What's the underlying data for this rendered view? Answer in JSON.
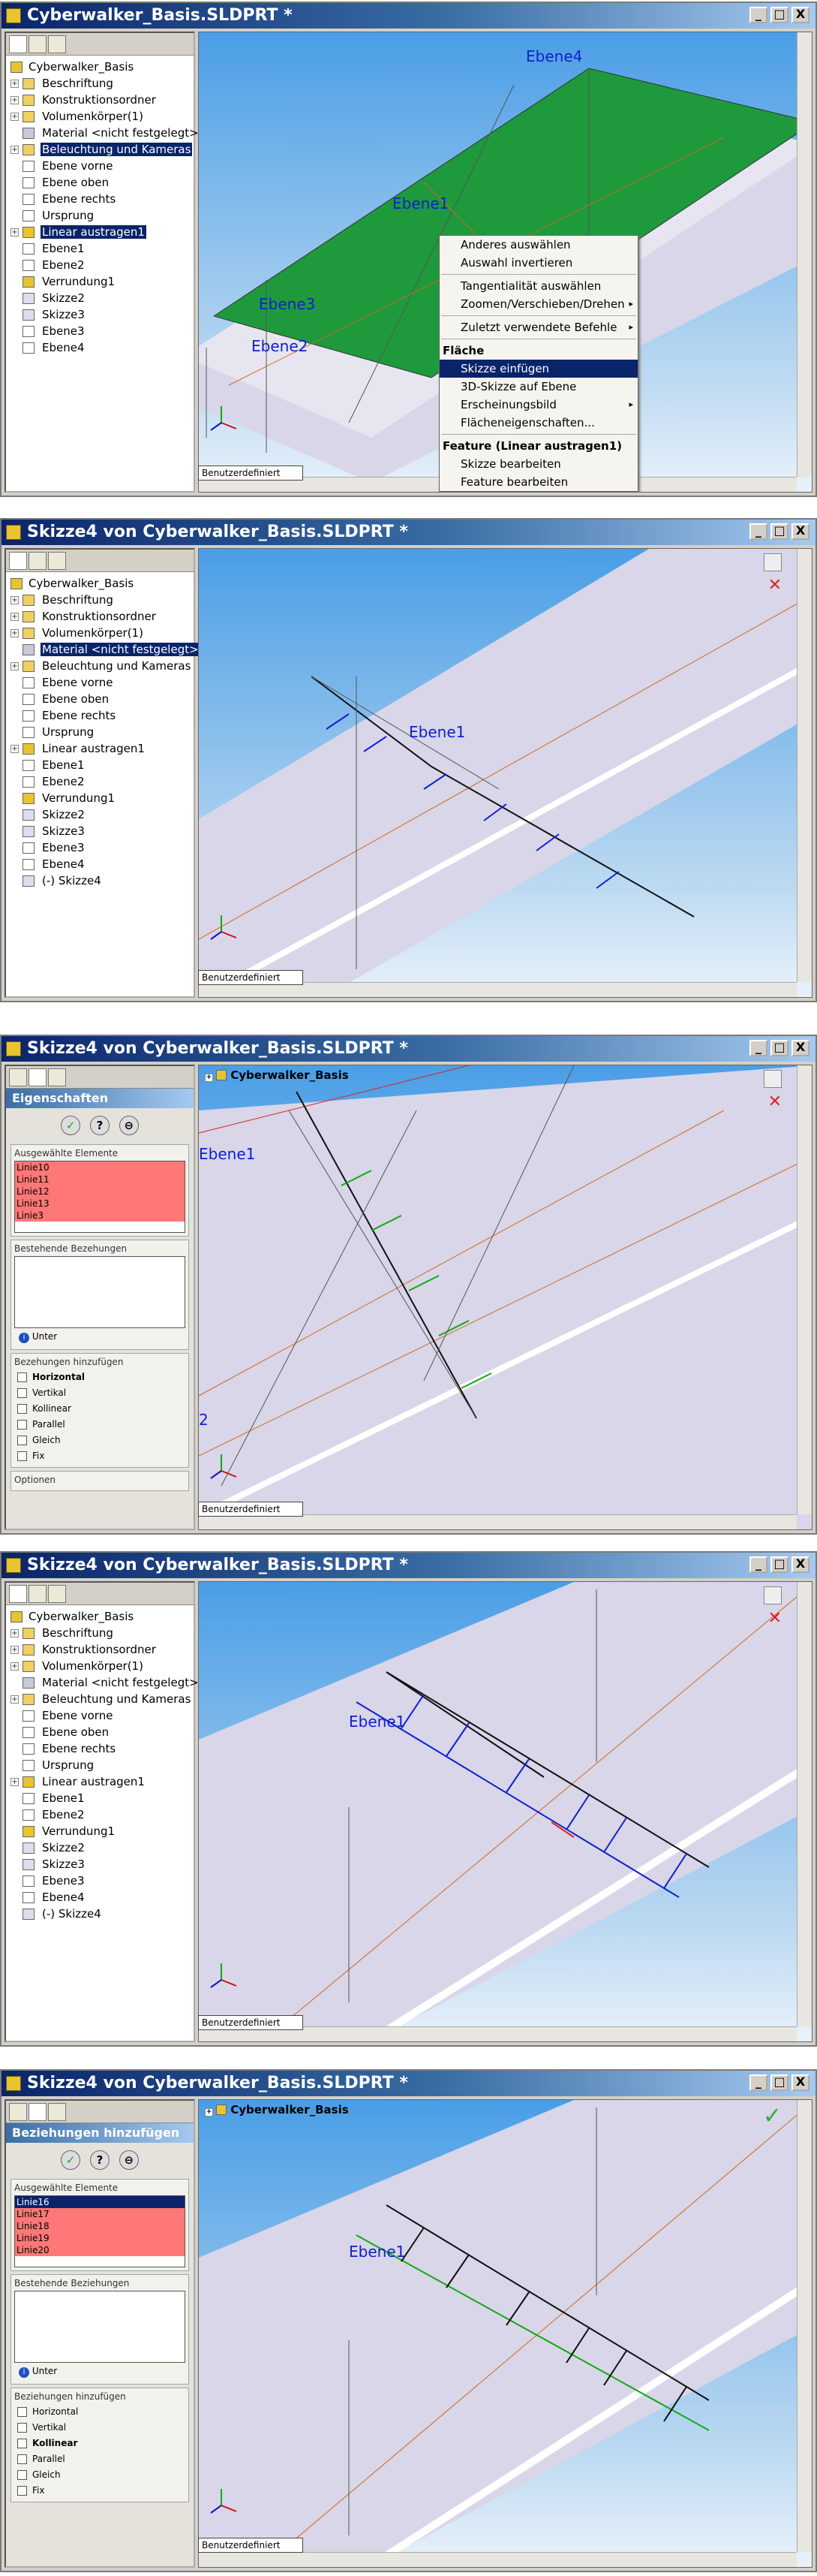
{
  "colors": {
    "titlebar": "#0a246a",
    "viewport_top": "#4a9ee6",
    "face_green": "#1e9a3c",
    "sketch_blue": "#1020d0",
    "sel_red": "#ff8080"
  },
  "window_controls": {
    "minimize": "_",
    "maximize": "□",
    "close": "X"
  },
  "panel1": {
    "title": "Cyberwalker_Basis.SLDPRT *",
    "tree": [
      {
        "label": "Cyberwalker_Basis",
        "icon": "part-icon"
      },
      {
        "label": "Beschriftung",
        "icon": "annotation-icon"
      },
      {
        "label": "Konstruktionsordner",
        "icon": "folder-icon"
      },
      {
        "label": "Volumenkörper(1)",
        "icon": "solid-body-icon"
      },
      {
        "label": "Material <nicht festgelegt>",
        "icon": "material-icon"
      },
      {
        "label": "Beleuchtung und Kameras",
        "icon": "lights-icon"
      },
      {
        "label": "Ebene vorne",
        "icon": "plane-icon"
      },
      {
        "label": "Ebene oben",
        "icon": "plane-icon"
      },
      {
        "label": "Ebene rechts",
        "icon": "plane-icon"
      },
      {
        "label": "Ursprung",
        "icon": "origin-icon"
      },
      {
        "label": "Linear austragen1",
        "icon": "extrude-icon"
      },
      {
        "label": "Ebene1",
        "icon": "plane-icon"
      },
      {
        "label": "Ebene2",
        "icon": "plane-icon"
      },
      {
        "label": "Verrundung1",
        "icon": "fillet-icon"
      },
      {
        "label": "Skizze2",
        "icon": "sketch-icon"
      },
      {
        "label": "Skizze3",
        "icon": "sketch-icon"
      },
      {
        "label": "Ebene3",
        "icon": "plane-icon"
      },
      {
        "label": "Ebene4",
        "icon": "plane-icon"
      }
    ],
    "view_labels": {
      "ebene1": "Ebene1",
      "ebene2": "Ebene2",
      "ebene3": "Ebene3",
      "ebene4": "Ebene4"
    },
    "view_orientation": "Benutzerdefiniert",
    "context_menu": [
      {
        "label": "Anderes auswählen",
        "kind": "item"
      },
      {
        "label": "Auswahl invertieren",
        "kind": "item"
      },
      {
        "kind": "sep"
      },
      {
        "label": "Tangentialität auswählen",
        "kind": "item"
      },
      {
        "label": "Zoomen/Verschieben/Drehen",
        "kind": "item",
        "submenu": "▸"
      },
      {
        "kind": "sep"
      },
      {
        "label": "Zuletzt verwendete Befehle",
        "kind": "item",
        "submenu": "▸"
      },
      {
        "kind": "sep"
      },
      {
        "label": "Fläche",
        "kind": "header"
      },
      {
        "label": "Skizze einfügen",
        "kind": "item",
        "highlight": true
      },
      {
        "label": "3D-Skizze auf Ebene",
        "kind": "item"
      },
      {
        "label": "Erscheinungsbild",
        "kind": "item",
        "submenu": "▸"
      },
      {
        "label": "Flächeneigenschaften...",
        "kind": "item"
      },
      {
        "kind": "sep"
      },
      {
        "label": "Feature (Linear austragen1)",
        "kind": "header"
      },
      {
        "label": "Skizze bearbeiten",
        "kind": "item"
      },
      {
        "label": "Feature bearbeiten",
        "kind": "item"
      }
    ]
  },
  "panel2": {
    "title": "Skizze4 von Cyberwalker_Basis.SLDPRT *",
    "tree_labels": [
      "Cyberwalker_Basis",
      "Beschriftung",
      "Konstruktionsordner",
      "Volumenkörper(1)",
      "Material <nicht festgelegt>",
      "Beleuchtung und Kameras",
      "Ebene vorne",
      "Ebene oben",
      "Ebene rechts",
      "Ursprung",
      "Linear austragen1",
      "Ebene1",
      "Ebene2",
      "Verrundung1",
      "Skizze2",
      "Skizze3",
      "Ebene3",
      "Ebene4",
      "(-) Skizze4"
    ],
    "selected_index": 4,
    "view_label": "Ebene1",
    "view_orientation": "Benutzerdefiniert"
  },
  "panel3": {
    "title": "Skizze4 von Cyberwalker_Basis.SLDPRT *",
    "pm_title": "Eigenschaften",
    "ok_buttons": [
      "✓",
      "?",
      "⊖"
    ],
    "selected_group": "Ausgewählte Elemente",
    "selected_items": [
      "Linie10",
      "Linie11",
      "Linie12",
      "Linie13",
      "Linie3"
    ],
    "existing_group": "Bestehende Bezehungen",
    "info": "Unter",
    "add_group": "Bezehungen hinzufügen",
    "relations": [
      {
        "label": "Horizontal",
        "bold": true
      },
      {
        "label": "Vertikal"
      },
      {
        "label": "Kollinear"
      },
      {
        "label": "Parallel"
      },
      {
        "label": "Gleich"
      },
      {
        "label": "Fix"
      }
    ],
    "options": "Optionen",
    "view_header": "Cyberwalker_Basis",
    "view_label": "Ebene1",
    "view_label2": "2",
    "view_orientation": "Benutzerdefiniert"
  },
  "panel4": {
    "title": "Skizze4 von Cyberwalker_Basis.SLDPRT *",
    "tree_labels": [
      "Cyberwalker_Basis",
      "Beschriftung",
      "Konstruktionsordner",
      "Volumenkörper(1)",
      "Material <nicht festgelegt>",
      "Beleuchtung und Kameras",
      "Ebene vorne",
      "Ebene oben",
      "Ebene rechts",
      "Ursprung",
      "Linear austragen1",
      "Ebene1",
      "Ebene2",
      "Verrundung1",
      "Skizze2",
      "Skizze3",
      "Ebene3",
      "Ebene4",
      "(-) Skizze4"
    ],
    "view_label": "Ebene1",
    "view_orientation": "Benutzerdefiniert"
  },
  "panel5": {
    "title": "Skizze4 von Cyberwalker_Basis.SLDPRT *",
    "pm_title": "Beziehungen hinzufügen",
    "ok_buttons": [
      "✓",
      "?",
      "⊖"
    ],
    "selected_group": "Ausgewählte Elemente",
    "selected_items": [
      "Linie16",
      "Linie17",
      "Linie18",
      "Linie19",
      "Linie20"
    ],
    "existing_group": "Bestehende Beziehungen",
    "info": "Unter",
    "add_group": "Beziehungen hinzufügen",
    "relations": [
      {
        "label": "Horizontal"
      },
      {
        "label": "Vertikal"
      },
      {
        "label": "Kollinear",
        "bold": true
      },
      {
        "label": "Parallel"
      },
      {
        "label": "Gleich"
      },
      {
        "label": "Fix"
      }
    ],
    "view_header": "Cyberwalker_Basis",
    "view_label": "Ebene1",
    "view_orientation": "Benutzerdefiniert"
  }
}
